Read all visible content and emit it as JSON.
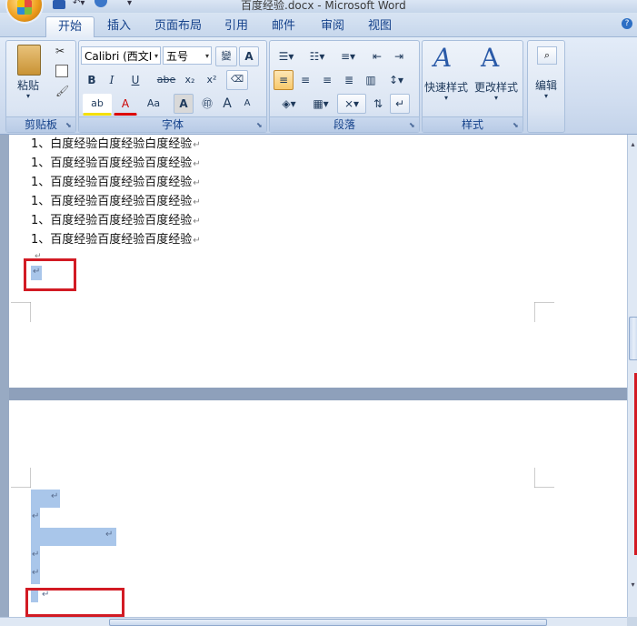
{
  "window": {
    "title": "百度经验.docx - Microsoft Word"
  },
  "tabs": [
    "开始",
    "插入",
    "页面布局",
    "引用",
    "邮件",
    "审阅",
    "视图"
  ],
  "clipboard": {
    "paste_label": "粘贴",
    "group_label": "剪贴板"
  },
  "font": {
    "family": "Calibri (西文Ⅰ",
    "size": "五号",
    "wen_label": "變",
    "A_label": "A",
    "bold": "B",
    "italic": "I",
    "underline": "U",
    "strike": "abe",
    "subscript": "x₂",
    "superscript": "x²",
    "highlight": "ab",
    "color_A": "A",
    "case_label": "Aa",
    "shade_A": "A",
    "grow": "A",
    "shrink": "A",
    "group_label": "字体"
  },
  "paragraph": {
    "group_label": "段落"
  },
  "styles": {
    "quick_label": "快速样式",
    "change_label": "更改样式",
    "group_label": "样式"
  },
  "editing": {
    "label": "编辑"
  },
  "document": {
    "lines": [
      "1、白度经验白度经验白度经验",
      "1、百度经验百度经验百度经验",
      "1、百度经验百度经验百度经验",
      "1、百度经验百度经验百度经验",
      "1、百度经验百度经验百度经验",
      "1、百度经验百度经验百度经验"
    ],
    "paragraph_mark": "↵"
  },
  "colors": {
    "annotation_red": "#d21b24",
    "selection": "#a9c6ea",
    "ribbon_text": "#15428b"
  }
}
